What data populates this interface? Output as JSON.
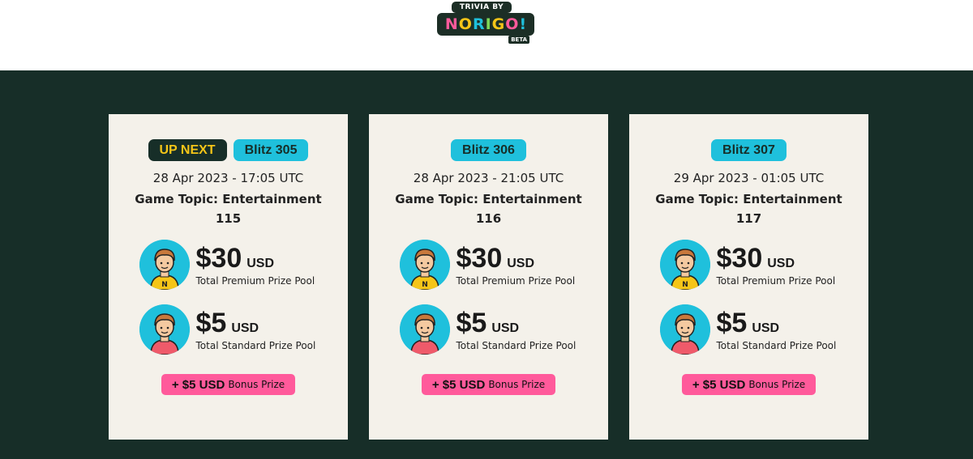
{
  "logo": {
    "top": "TRIVIA BY",
    "word": [
      "N",
      "O",
      "R",
      "I",
      "G",
      "O",
      "!"
    ],
    "word_colors": [
      "#ff5a9b",
      "#f5c518",
      "#1fc0dc",
      "#7ed957",
      "#f5c518",
      "#ff5a9b",
      "#1fc0dc"
    ],
    "beta": "BETA"
  },
  "colors": {
    "background": "#172e28",
    "card": "#f4f1ea",
    "accent_blue": "#1fc0dc",
    "accent_yellow": "#f5c518",
    "accent_pink": "#ff5a9b"
  },
  "cards": [
    {
      "up_next": "UP NEXT",
      "blitz": "Blitz 305",
      "date": "28 Apr 2023 - 17:05 UTC",
      "topic": "Game Topic: Entertainment",
      "number": "115",
      "premium_amount": "$30",
      "premium_currency": "USD",
      "premium_label": "Total Premium Prize Pool",
      "standard_amount": "$5",
      "standard_currency": "USD",
      "standard_label": "Total Standard Prize Pool",
      "bonus_amount": "+ $5 USD",
      "bonus_label": "Bonus Prize"
    },
    {
      "blitz": "Blitz 306",
      "date": "28 Apr 2023 - 21:05 UTC",
      "topic": "Game Topic: Entertainment",
      "number": "116",
      "premium_amount": "$30",
      "premium_currency": "USD",
      "premium_label": "Total Premium Prize Pool",
      "standard_amount": "$5",
      "standard_currency": "USD",
      "standard_label": "Total Standard Prize Pool",
      "bonus_amount": "+ $5 USD",
      "bonus_label": "Bonus Prize"
    },
    {
      "blitz": "Blitz 307",
      "date": "29 Apr 2023 - 01:05 UTC",
      "topic": "Game Topic: Entertainment",
      "number": "117",
      "premium_amount": "$30",
      "premium_currency": "USD",
      "premium_label": "Total Premium Prize Pool",
      "standard_amount": "$5",
      "standard_currency": "USD",
      "standard_label": "Total Standard Prize Pool",
      "bonus_amount": "+ $5 USD",
      "bonus_label": "Bonus Prize"
    }
  ]
}
